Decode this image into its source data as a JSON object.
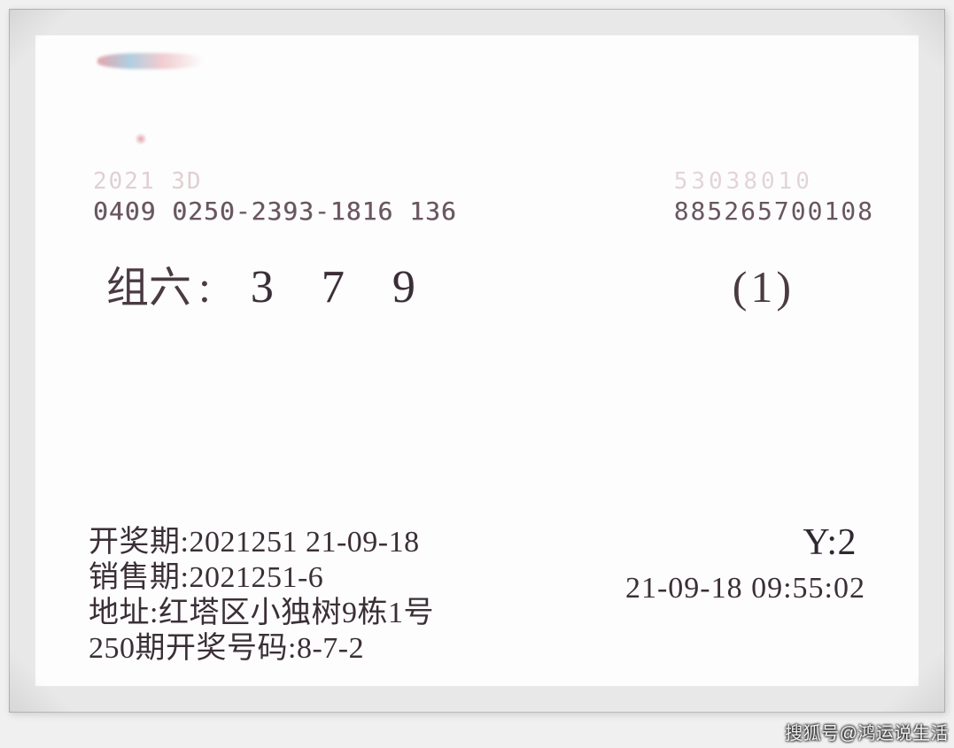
{
  "serial": {
    "left_faded": "2021  3D",
    "left_code": "0409 0250-2393-1816 136",
    "right_faded": "53038010",
    "right_code": "885265700108"
  },
  "play": {
    "group_label": "组六",
    "colon": ":",
    "d1": "3",
    "d2": "7",
    "d3": "9",
    "multiplier": "(1)"
  },
  "footer": {
    "draw_label": "开奖期:",
    "draw_value": "2021251 21-09-18",
    "sale_label": "销售期:",
    "sale_value": "2021251-6",
    "addr_label": "地址:",
    "addr_value": "红塔区小独树9栋1号",
    "prev_label": "250期开奖号码:",
    "prev_value": "8-7-2",
    "price_label": "Y:",
    "price_value": "2",
    "timestamp": "21-09-18 09:55:02"
  },
  "watermark": "搜狐号@鸿运说生活"
}
